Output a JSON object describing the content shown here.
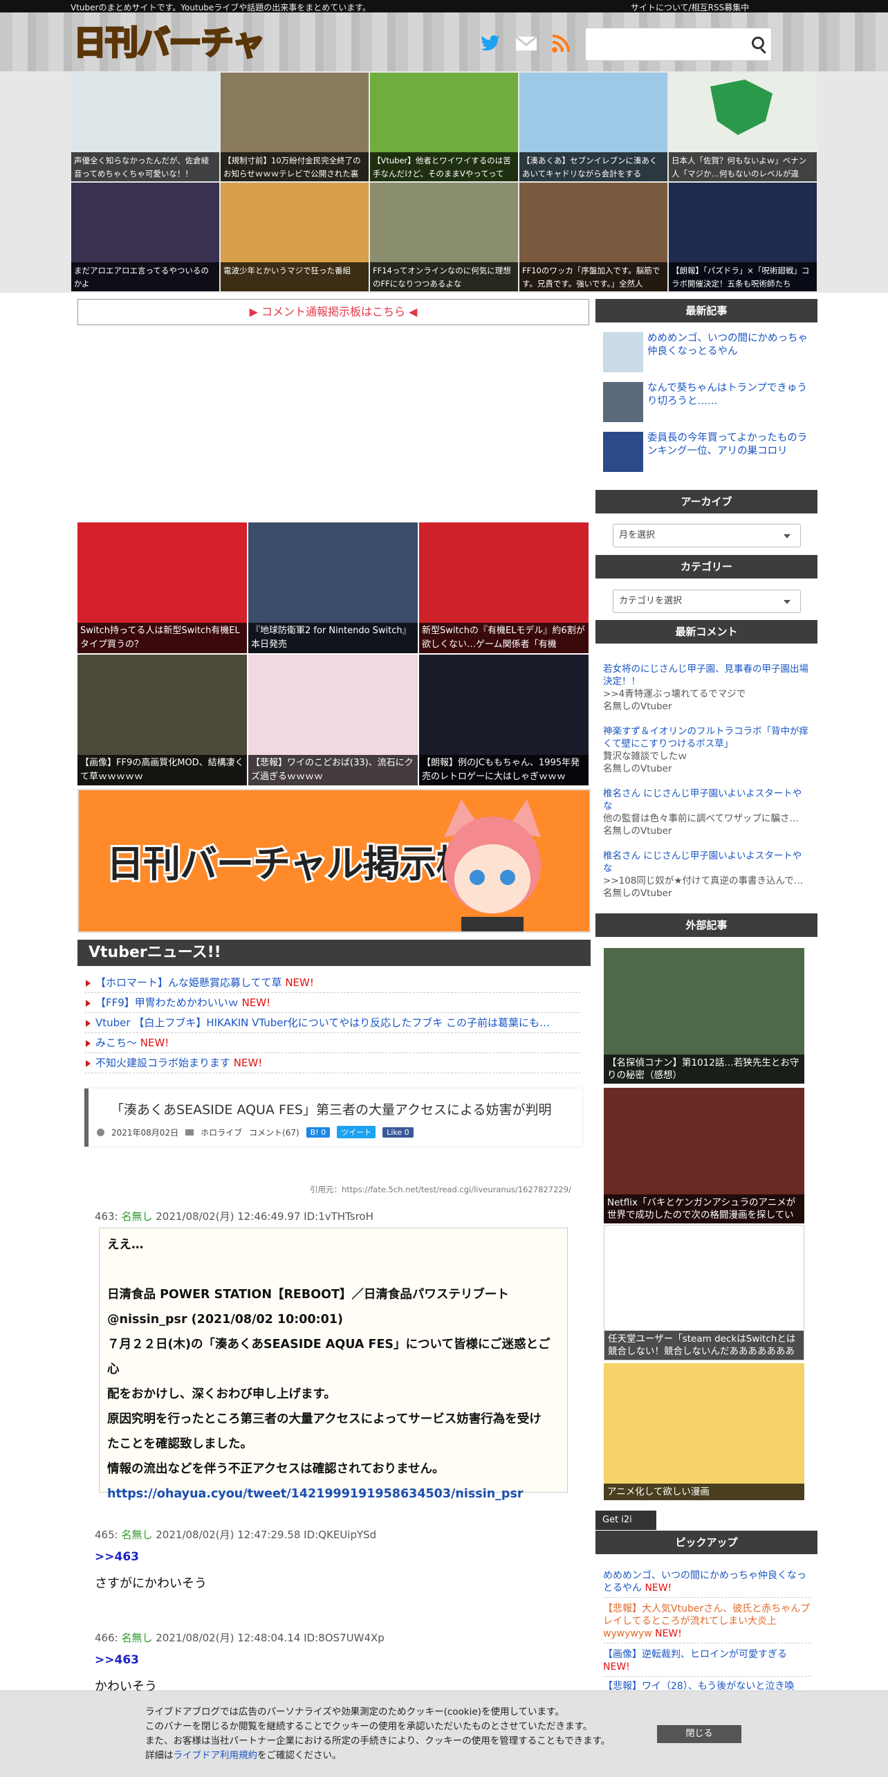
{
  "topbar": {
    "tagline": "Vtuberのまとめサイトです。Youtubeライブや話題の出来事をまとめています。",
    "about": "サイトについて/相互RSS募集中"
  },
  "header": {
    "logo": "日刊バーチャル",
    "search_placeholder": ""
  },
  "featured": [
    {
      "caption": "声優全く知らなかったんだが、佐倉綾音ってめちゃくちゃ可愛いな！！",
      "color": "#dfe6ea"
    },
    {
      "caption": "【規制寸前】10万紛付金民完全終了のお知らせｗｗｗテレビで公開された裏",
      "color": "#8a7a5c"
    },
    {
      "caption": "【Vtuber】他者とワイワイするのは苦手なんだけど、そのままVやってって",
      "color": "#6fae3e"
    },
    {
      "caption": "【湊あくあ】セブンイレブンに湊あくあいてキャドリながら会計をする",
      "color": "#9ec9e6"
    },
    {
      "caption": "日本人「佐賀？何もないよｗ」ベナン人「マジか…何もないのレベルが違",
      "color": "#e9efe6"
    },
    {
      "caption": "まだアロエアロエ言ってるやついるのかよ",
      "color": "#3a3050"
    },
    {
      "caption": "電波少年とかいうマジで狂った番組",
      "color": "#d8a04a"
    },
    {
      "caption": "FF14ってオンラインなのに何気に理想のFFになりつつあるよな",
      "color": "#8a8d6e"
    },
    {
      "caption": "FF10のワッカ「序盤加入です。脳筋です。兄貴です。強いです。」全然人",
      "color": "#7a5a3e"
    },
    {
      "caption": "【朗報】「パズドラ」×「呪術廻戦」コラボ開催決定！五条も呪術師たち",
      "color": "#1f2a4e"
    }
  ],
  "comment_board": "▶ コメント通報掲示板はこちら ◀",
  "articles": [
    {
      "caption": "Switch持ってる人は新型Switch有機ELタイプ買うの？",
      "color": "#d4202a"
    },
    {
      "caption": "『地球防衛軍2 for Nintendo Switch』本日発売",
      "color": "#3c4d6a"
    },
    {
      "caption": "新型Switchの『有機ELモデル』約6割が欲しくない…ゲーム関係者「有機",
      "color": "#cf2129"
    },
    {
      "caption": "【画像】FF9の高画質化MOD、結構凄くて草ｗｗｗｗｗ",
      "color": "#4e4a3a"
    },
    {
      "caption": "【悲報】ワイのこどおば(33)、流石にクズ過ぎるｗｗｗｗ",
      "color": "#f2d8e0"
    },
    {
      "caption": "【朗報】例のJCももちゃん、1995年発売のレトロゲーに大はしゃぎｗｗｗ",
      "color": "#1a1c2a"
    }
  ],
  "board_banner": "日刊バーチャル掲示板",
  "news": {
    "heading": "Vtuberニュース!!",
    "new_label": "NEW!",
    "items": [
      {
        "text": "【ホロマート】んな姫懸賞応募してて草 ",
        "new": "NEW!"
      },
      {
        "text": "【FF9】甲冑わためかわいいｗ ",
        "new": "NEW!"
      },
      {
        "text": "Vtuber 【白上フブキ】HIKAKIN VTuber化についてやはり反応したフブキ この子前は葛葉にも…",
        "new": ""
      },
      {
        "text": "みこち～ ",
        "new": "NEW!"
      },
      {
        "text": "不知火建設コラボ始まります ",
        "new": "NEW!"
      }
    ]
  },
  "post": {
    "title": "「湊あくあSEASIDE AQUA FES」第三者の大量アクセスによる妨害が判明",
    "date": "2021年08月02日",
    "category": "ホロライブ",
    "comments": "コメント(67)",
    "hatena": "B! 0",
    "tweet": "ツイート",
    "like": "Like 0",
    "quote": "引用元：https://fate.5ch.net/test/read.cgi/liveuranus/1627827229/",
    "responses": [
      {
        "no": "463:",
        "name": "名無し",
        "meta": "2021/08/02(月) 12:46:49.97 ID:1vTHTsroH"
      },
      {
        "no": "465:",
        "name": "名無し",
        "meta": "2021/08/02(月) 12:47:29.58 ID:QKEUipYSd",
        "anchor": ">>463",
        "text": "さすがにかわいそう"
      },
      {
        "no": "466:",
        "name": "名無し",
        "meta": "2021/08/02(月) 12:48:04.14 ID:8OS7UW4Xp",
        "anchor": ">>463",
        "text": "かわいそう"
      }
    ],
    "res463": [
      "ええ…",
      "",
      "日清食品 POWER STATION【REBOOT】／日清食品パワステリブート",
      "@nissin_psr (2021/08/02 10:00:01)",
      "７月２２日(木)の「湊あくあSEASIDE AQUA FES」について皆様にご迷惑とご心",
      "配をおかけし、深くおわび申し上げます。",
      "原因究明を行ったところ第三者の大量アクセスによってサービス妨害行為を受け",
      "たことを確認致しました。",
      "情報の流出などを伴う不正アクセスは確認されておりません。"
    ],
    "res463_link": "https://ohayua.cyou/tweet/1421999191958634503/nissin_psr"
  },
  "sidebar": {
    "latest_heading": "最新記事",
    "latest": [
      {
        "title": "めめめンゴ、いつの間にかめっちゃ仲良くなっとるやん"
      },
      {
        "title": "なんで葵ちゃんはトランプできゅうり切ろうと……"
      },
      {
        "title": "委員長の今年買ってよかったものランキング一位、アリの巣コロリ"
      }
    ],
    "archive_heading": "アーカイブ",
    "archive_select": "月を選択",
    "category_heading": "カテゴリー",
    "category_select": "カテゴリを選択",
    "recent_comments_heading": "最新コメント",
    "recent_comments": [
      {
        "title": "若女将のにじさんじ甲子園、見事春の甲子園出場決定！！",
        "body": ">>4青特運ぶっ壊れてるでマジで",
        "author": "名無しのVtuber"
      },
      {
        "title": "神楽すず＆イオリンのフルトラコラボ「背中が痒くて壁にこすりつけるボス草」",
        "body": "贅沢な雑談でしたｗ",
        "author": "名無しのVtuber"
      },
      {
        "title": "椎名さん にじさんじ甲子園いよいよスタートやな",
        "body": "他の監督は色々事前に調べてワザップに騙さ…",
        "author": "名無しのVtuber"
      },
      {
        "title": "椎名さん にじさんじ甲子園いよいよスタートやな",
        "body": ">>108同じ奴が★付けて真逆の事書き込んで…",
        "author": "名無しのVtuber"
      }
    ],
    "external_heading": "外部記事",
    "external": [
      {
        "caption": "【名探偵コナン】第1012話…若狭先生とお守りの秘密（感想）",
        "color": "#4f6a4a"
      },
      {
        "caption": "Netflix「バキとケンガンアシュラのアニメが世界で成功したので次の格闘漫画を探してい",
        "color": "#6a2a24"
      },
      {
        "caption": "任天堂ユーザー「steam deckはSwitchとは競合しない！競合しないんだあああああああ",
        "color": "#ffffff"
      },
      {
        "caption": "アニメ化して欲しい漫画",
        "color": "#f5d36a"
      }
    ],
    "get_label": "Get i2i",
    "pickup_heading": "ピックアップ",
    "pickup": [
      {
        "text": "めめめンゴ、いつの間にかめっちゃ仲良くなっとるやん ",
        "new": "NEW!",
        "color": "#1a56c4"
      },
      {
        "text": "【悲報】大人気Vtuberさん、彼氏と赤ちゃんプレイしてるところが流れてしまい大炎上 wywywyw ",
        "new": "NEW!",
        "color": "#e06a2a"
      },
      {
        "text": "【画像】逆転裁判、ヒロインが可愛すぎる ",
        "new": "NEW!",
        "color": "#1a56c4"
      },
      {
        "text": "【悲報】ワイ（28）、もう後がないと泣き喚",
        "new": "",
        "color": "#1a56c4"
      }
    ]
  },
  "cookie": {
    "lines": [
      "ライブドアブログでは広告のパーソナライズや効果測定のためクッキー(cookie)を使用しています。",
      "このバナーを閉じるか閲覧を継続することでクッキーの使用を承認いただいたものとさせていただきます。",
      "また、お客様は当社パートナー企業における所定の手続きにより、クッキーの使用を管理することもできます。"
    ],
    "detail_prefix": "詳細は",
    "detail_link": "ライブドア利用規約",
    "detail_suffix": "をご確認ください。",
    "close": "閉じる"
  }
}
